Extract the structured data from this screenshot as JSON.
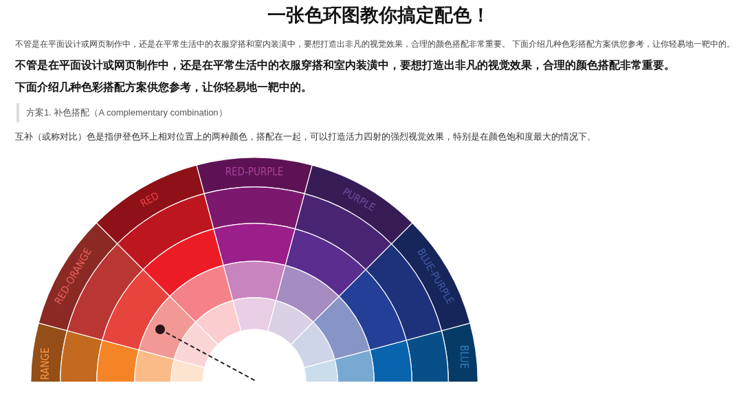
{
  "title": "一张色环图教你搞定配色！",
  "intro": "不管是在平面设计或网页制作中，还是在平常生活中的衣服穿搭和室内装潢中，要想打造出非凡的视觉效果，合理的颜色搭配非常重要。 下面介绍几种色彩搭配方案供您参考，让你轻易地一靶中的。",
  "bold_paragraphs": [
    "不管是在平面设计或网页制作中，还是在平常生活中的衣服穿搭和室内装潢中，要想打造出非凡的视觉效果，合理的颜色搭配非常重要。",
    "下面介绍几种色彩搭配方案供您参考，让你轻易地一靶中的。"
  ],
  "blockquote": "方案1. 补色搭配（A complementary combination）",
  "body": "互补（或称对比）色是指伊登色环上相对位置上的两种颜色，搭配在一起，可以打造活力四射的强烈视觉效果，特别是在颜色饱和度最大的情况下。",
  "color_wheel": {
    "hues": [
      {
        "label": "BLUE",
        "color": "#0a63ad"
      },
      {
        "label": "BLUE-PURPLE",
        "color": "#243f98"
      },
      {
        "label": "PURPLE",
        "color": "#5b2d8e"
      },
      {
        "label": "RED-PURPLE",
        "color": "#9b1f8a"
      },
      {
        "label": "RED",
        "color": "#ec1c26"
      },
      {
        "label": "RED-ORANGE",
        "color": "#e8443e"
      },
      {
        "label": "RANGE",
        "color": "#f58426"
      }
    ]
  }
}
